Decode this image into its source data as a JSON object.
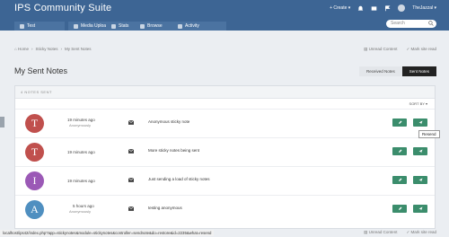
{
  "header": {
    "title": "IPS Community Suite",
    "create_label": "Create",
    "username": "TheJazzal",
    "search_placeholder": "Search"
  },
  "nav": [
    {
      "label": "Test"
    },
    {
      "label": "Media Uploader"
    },
    {
      "label": "Stats"
    },
    {
      "label": "Browse"
    },
    {
      "label": "Activity"
    }
  ],
  "breadcrumb": {
    "home": "Home",
    "sep": "›",
    "parent": "Sticky Notes",
    "current": "My Sent Notes"
  },
  "top_links": {
    "unread": "Unread Content",
    "mark": "Mark site read"
  },
  "page": {
    "title": "My Sent Notes"
  },
  "toggle": {
    "received": "Received Notes",
    "sent": "Sent Notes"
  },
  "panel": {
    "count_label": "4 NOTES SENT",
    "sort_label": "SORT BY ▾"
  },
  "rows": [
    {
      "initial": "T",
      "color": "#c0504d",
      "time": "19 minutes ago",
      "who": "Anonymously",
      "note": "Anonymous sticky note"
    },
    {
      "initial": "T",
      "color": "#c0504d",
      "time": "19 minutes ago",
      "who": "",
      "note": "More sticky notes being sent"
    },
    {
      "initial": "I",
      "color": "#9b59b6",
      "time": "19 minutes ago",
      "who": "",
      "note": "Just sending a load of sticky notes"
    },
    {
      "initial": "A",
      "color": "#4f8fc0",
      "time": "5 hours ago",
      "who": "Anonymously",
      "note": "testing anonymous"
    }
  ],
  "tooltip": "Resend",
  "status_url": "localhost/ips42/index.php?app=stickynotes&module=stickynotes&controller=sendnote&do=restore&id=2235&what=resend",
  "bottom_links": {
    "unread": "Unread Content",
    "mark": "Mark site read"
  },
  "colors": {
    "header": "#3d6594",
    "action_button": "#3b8d6c"
  }
}
